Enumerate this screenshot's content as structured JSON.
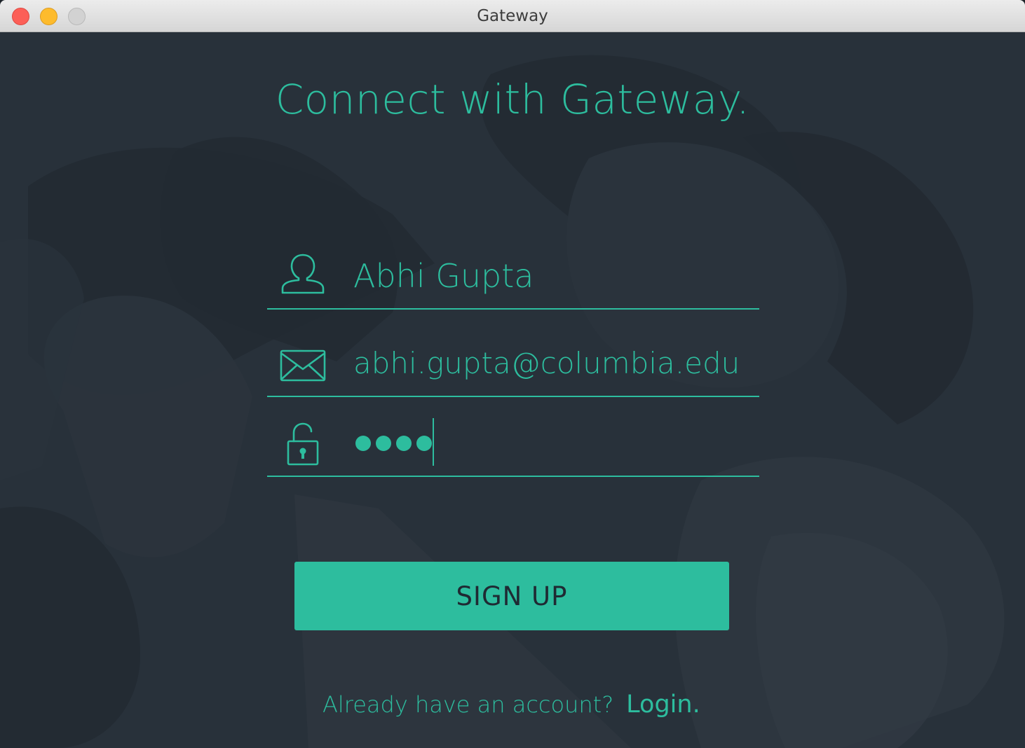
{
  "window": {
    "title": "Gateway"
  },
  "heading": "Connect with Gateway.",
  "form": {
    "name": {
      "icon": "user-icon",
      "value": "Abhi Gupta"
    },
    "email": {
      "icon": "envelope-icon",
      "value": "abhi.gupta@columbia.edu"
    },
    "password": {
      "icon": "unlocked-padlock-icon",
      "masked_length": 4
    }
  },
  "signup_button": "SIGN UP",
  "footer": {
    "prompt": "Already have an account?",
    "login_label": "Login."
  },
  "colors": {
    "accent": "#2dbd9e",
    "background": "#28313a",
    "button_text": "#1f2a33"
  }
}
